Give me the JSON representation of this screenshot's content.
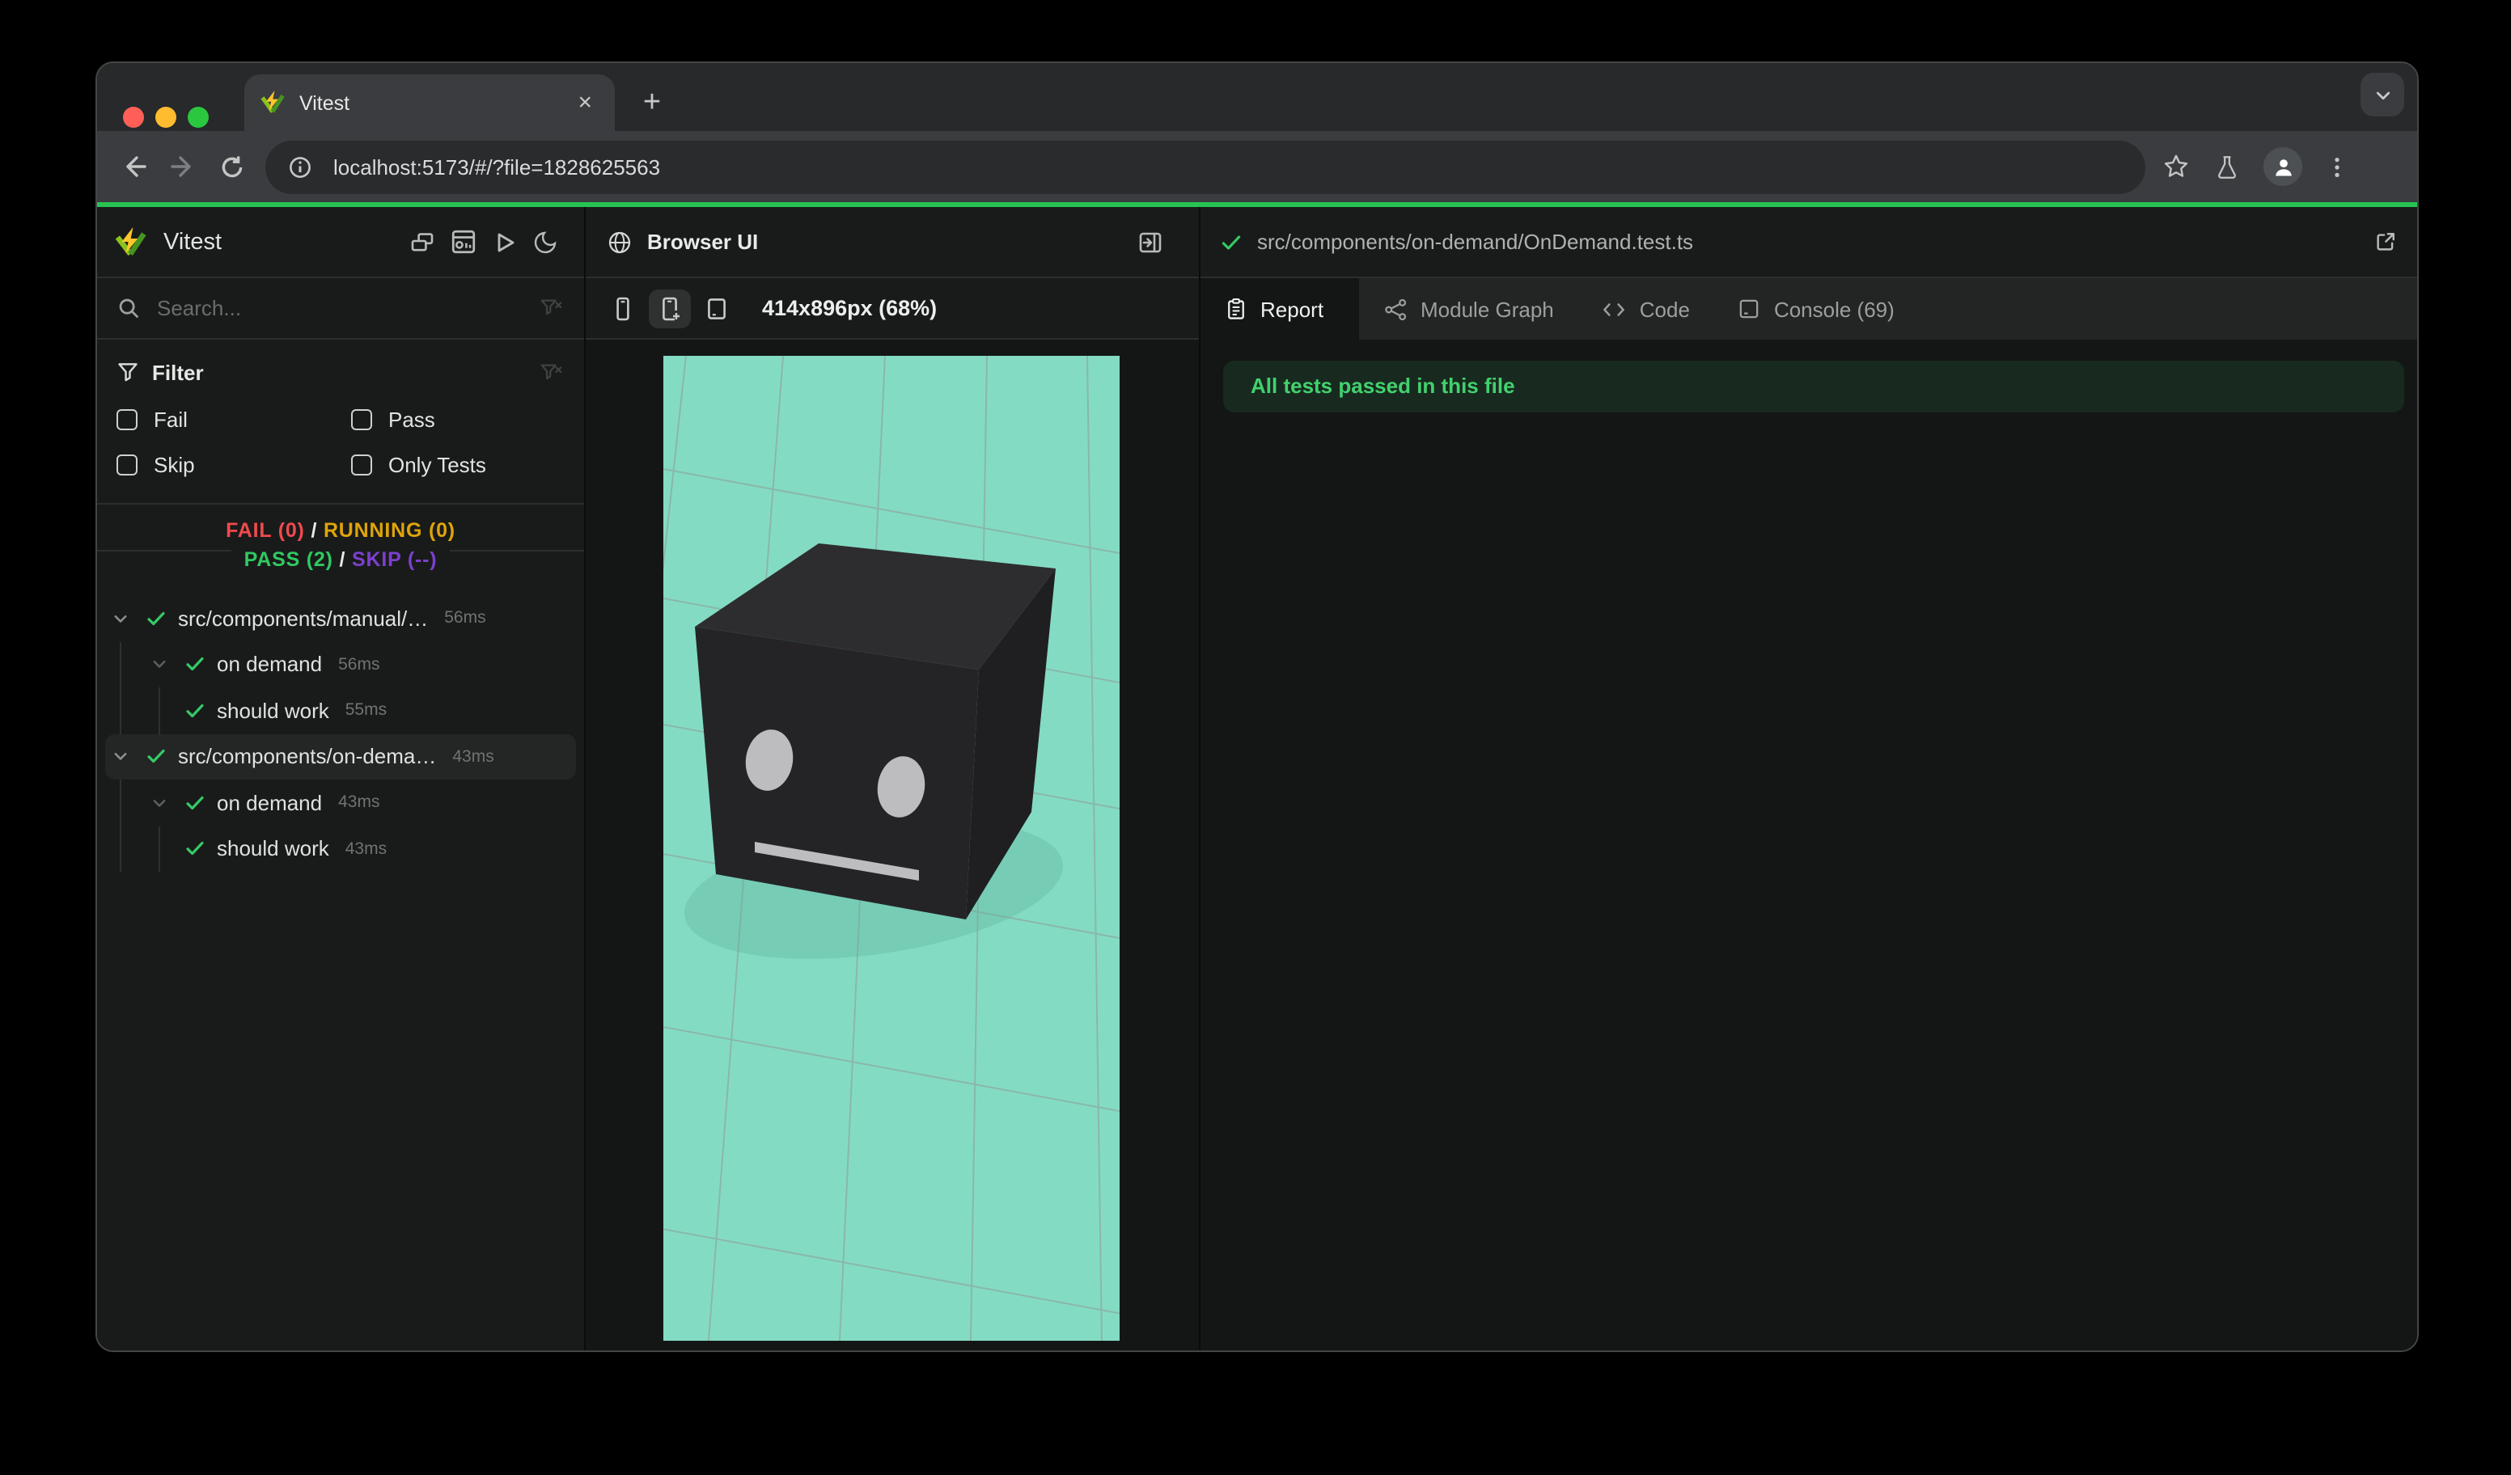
{
  "browser": {
    "tab_title": "Vitest",
    "url": "localhost:5173/#/?file=1828625563"
  },
  "colors": {
    "progress_bar": "#27c454",
    "fail": "#ef4a4e",
    "running": "#dfa40b",
    "pass": "#30c961",
    "skip": "#7d3fcf",
    "preview_background": "#84dbc3",
    "banner_background": "#182a1f",
    "banner_text": "#42d16e"
  },
  "sidebar": {
    "app_name": "Vitest",
    "search_placeholder": "Search...",
    "filter": {
      "title": "Filter",
      "options": [
        {
          "label": "Fail",
          "checked": false
        },
        {
          "label": "Pass",
          "checked": false
        },
        {
          "label": "Skip",
          "checked": false
        },
        {
          "label": "Only Tests",
          "checked": false
        }
      ]
    },
    "summary": {
      "fail": "FAIL (0)",
      "sep1": "/",
      "running": "RUNNING (0)",
      "pass": "PASS (2)",
      "sep2": "/",
      "skip": "SKIP (--)"
    },
    "tree": [
      {
        "label": "src/components/manual/…",
        "duration": "56ms",
        "type": "file",
        "status": "pass"
      },
      {
        "label": "on demand",
        "duration": "56ms",
        "type": "suite",
        "status": "pass"
      },
      {
        "label": "should work",
        "duration": "55ms",
        "type": "test",
        "status": "pass"
      },
      {
        "label": "src/components/on-dema…",
        "duration": "43ms",
        "type": "file",
        "status": "pass",
        "selected": true
      },
      {
        "label": "on demand",
        "duration": "43ms",
        "type": "suite",
        "status": "pass"
      },
      {
        "label": "should work",
        "duration": "43ms",
        "type": "test",
        "status": "pass"
      }
    ]
  },
  "preview": {
    "title": "Browser UI",
    "size_label": "414x896px (68%)"
  },
  "report": {
    "file_path": "src/components/on-demand/OnDemand.test.ts",
    "tabs": [
      {
        "label": "Report",
        "active": true
      },
      {
        "label": "Module Graph",
        "active": false
      },
      {
        "label": "Code",
        "active": false
      },
      {
        "label": "Console (69)",
        "active": false
      }
    ],
    "banner": "All tests passed in this file"
  }
}
